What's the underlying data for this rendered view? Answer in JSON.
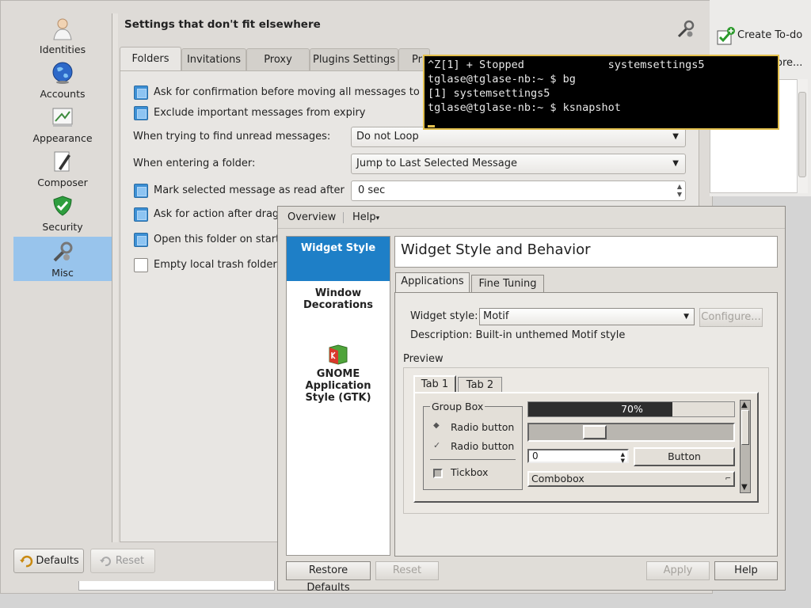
{
  "kmail": {
    "sidebar": [
      {
        "label": "Identities",
        "icon": "identities-icon"
      },
      {
        "label": "Accounts",
        "icon": "accounts-globe-icon"
      },
      {
        "label": "Appearance",
        "icon": "appearance-icon"
      },
      {
        "label": "Composer",
        "icon": "composer-pen-icon"
      },
      {
        "label": "Security",
        "icon": "security-shield-icon"
      },
      {
        "label": "Misc",
        "icon": "misc-tools-icon",
        "selected": true
      }
    ],
    "header_title": "Settings that don't fit elsewhere",
    "tabs": [
      "Folders",
      "Invitations",
      "Proxy",
      "Plugins Settings",
      "Pri"
    ],
    "rows": {
      "ask_confirm": "Ask for confirmation before moving all messages to tra",
      "exclude_expiry": "Exclude important messages from expiry",
      "unread_label": "When trying to find unread messages:",
      "unread_value": "Do not Loop",
      "entering_label": "When entering a folder:",
      "entering_value": "Jump to Last Selected Message",
      "mark_read": "Mark selected message as read after",
      "mark_read_value": "0 sec",
      "ask_action": "Ask for action after dragg",
      "open_folder": "Open this folder on startu",
      "empty_trash": "Empty local trash folder o"
    },
    "defaults_button": "Defaults",
    "reset_button": "Reset"
  },
  "right_panel": {
    "create_todo": "Create To-do",
    "more": "ore..."
  },
  "terminal": {
    "lines": [
      "^Z[1] + Stopped             systemsettings5",
      "tglase@tglase-nb:~ $ bg",
      "[1] systemsettings5",
      "tglase@tglase-nb:~ $ ksnapshot"
    ]
  },
  "motif": {
    "menu": [
      "Overview",
      "Help"
    ],
    "help_suffix": "▾",
    "side": [
      "Widget Style",
      "Window Decorations",
      "GNOME Application Style (GTK)"
    ],
    "title": "Widget Style and Behavior",
    "tabs": [
      "Applications",
      "Fine Tuning"
    ],
    "widget_style_label": "Widget style:",
    "widget_style_value": "Motif",
    "configure": "Configure...",
    "description": "Description: Built-in unthemed Motif style",
    "preview_label": "Preview",
    "preview_tabs": [
      "Tab 1",
      "Tab 2"
    ],
    "group_box": "Group Box",
    "radio1": "Radio button",
    "radio2": "Radio button",
    "tickbox": "Tickbox",
    "progress": 0.7,
    "progress_text": "70%",
    "slider_value": 0.3,
    "spin_value": "0",
    "button": "Button",
    "combobox": "Combobox",
    "restore_defaults": "Restore Defaults",
    "reset": "Reset",
    "apply": "Apply",
    "help": "Help"
  },
  "colors": {
    "selection_blue": "#1e7fc7",
    "sidebar_selected": "#98c4ec",
    "checkbox_on": "#3c8fd4",
    "terminal_border": "#e3c04d"
  }
}
